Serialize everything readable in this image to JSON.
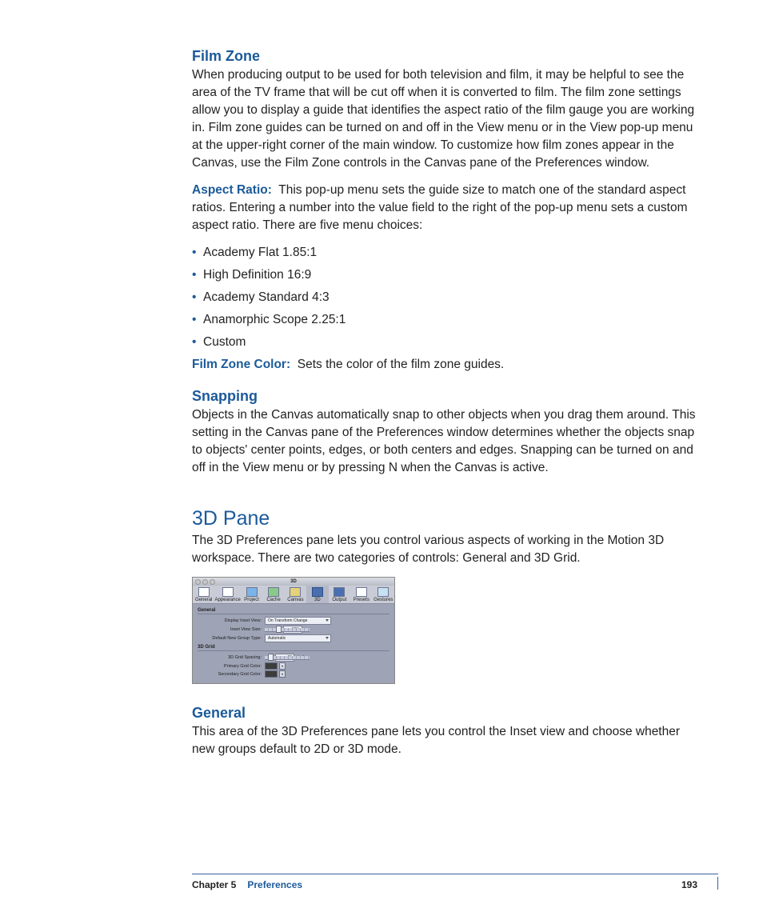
{
  "sections": {
    "filmZone": {
      "heading": "Film Zone",
      "para1": "When producing output to be used for both television and film, it may be helpful to see the area of the TV frame that will be cut off when it is converted to film. The film zone settings allow you to display a guide that identifies the aspect ratio of the film gauge you are working in. Film zone guides can be turned on and off in the View menu or in the View pop-up menu at the upper-right corner of the main window. To customize how film zones appear in the Canvas, use the Film Zone controls in the Canvas pane of the Preferences window.",
      "aspectRatio": {
        "label": "Aspect Ratio:",
        "text": "This pop-up menu sets the guide size to match one of the standard aspect ratios. Entering a number into the value field to the right of the pop-up menu sets a custom aspect ratio. There are five menu choices:",
        "choices": [
          "Academy Flat 1.85:1",
          "High Definition 16:9",
          "Academy Standard 4:3",
          "Anamorphic Scope 2.25:1",
          "Custom"
        ]
      },
      "filmZoneColor": {
        "label": "Film Zone Color:",
        "text": "Sets the color of the film zone guides."
      }
    },
    "snapping": {
      "heading": "Snapping",
      "para": "Objects in the Canvas automatically snap to other objects when you drag them around. This setting in the Canvas pane of the Preferences window determines whether the objects snap to objects' center points, edges, or both centers and edges. Snapping can be turned on and off in the View menu or by pressing N when the Canvas is active."
    },
    "threeDPane": {
      "heading": "3D Pane",
      "para": "The 3D Preferences pane lets you control various aspects of working in the Motion 3D workspace. There are two categories of controls: General and 3D Grid."
    },
    "general": {
      "heading": "General",
      "para": "This area of the 3D Preferences pane lets you control the Inset view and choose whether new groups default to 2D or 3D mode."
    }
  },
  "prefsWindow": {
    "title": "3D",
    "tabs": [
      "General",
      "Appearance",
      "Project",
      "Cache",
      "Canvas",
      "3D",
      "Output",
      "Presets",
      "Gestures"
    ],
    "generalSection": {
      "title": "General",
      "rows": {
        "displayInsetView": {
          "label": "Display Inset View:",
          "value": "On Transform Change"
        },
        "insetViewSize": {
          "label": "Inset View Size:",
          "value": "30%"
        },
        "defaultGroup": {
          "label": "Default New Group Type:",
          "value": "Automatic"
        }
      }
    },
    "gridSection": {
      "title": "3D Grid",
      "rows": {
        "gridSpacing": {
          "label": "3D Grid Spacing:",
          "value": "80",
          "unit": "pixels"
        },
        "primaryColor": {
          "label": "Primary Grid Color:"
        },
        "secondaryColor": {
          "label": "Secondary Grid Color:"
        }
      }
    }
  },
  "footer": {
    "chapter": "Chapter 5",
    "title": "Preferences",
    "page": "193"
  }
}
